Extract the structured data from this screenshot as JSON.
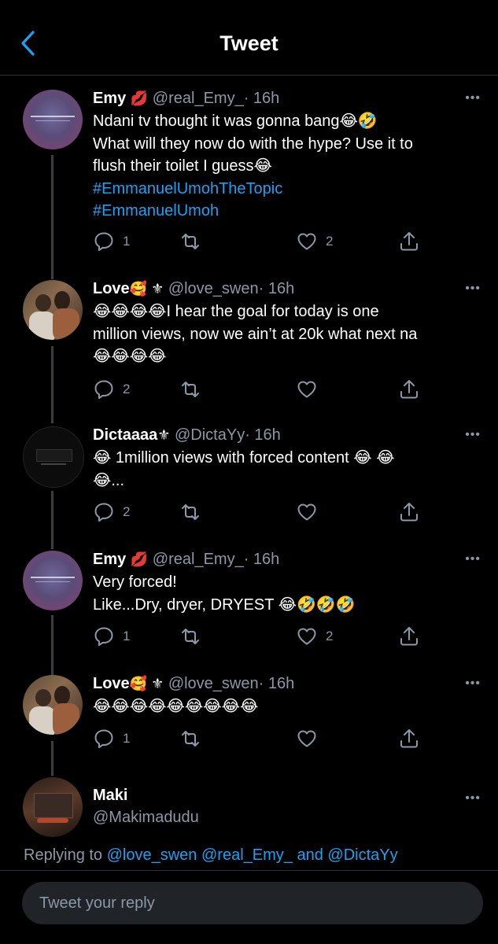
{
  "header": {
    "title": "Tweet",
    "back_icon": "chevron-left-icon"
  },
  "colors": {
    "accent": "#1da1f2",
    "muted": "#8b98a5",
    "background": "#000000"
  },
  "tweets": [
    {
      "name": "Emy",
      "badge": "💋",
      "handle": "@real_Emy_",
      "time": "· 16h",
      "lines": [
        "Ndani tv thought it was gonna bang😂🤣",
        "What will they now do with the hype? Use it to",
        "flush their toilet I guess😂"
      ],
      "hashtags": [
        "#EmmanuelUmohTheTopic",
        "#EmmanuelUmoh"
      ],
      "replies": "1",
      "retweets": "",
      "likes": "2"
    },
    {
      "name": "Love",
      "badge": "🥰 ⚜",
      "handle": "@love_swen",
      "time": "· 16h",
      "lines": [
        "😂😂😂😂I hear the goal for  today is one",
        "million views, now we ain’t at 20k what next na",
        "😂😂😂😂"
      ],
      "replies": "2",
      "retweets": "",
      "likes": ""
    },
    {
      "name": "Dictaaaa",
      "badge": "⚜",
      "handle": "@DictaYy",
      "time": "· 16h",
      "lines": [
        "😂 1million views with forced content 😂 😂",
        "😂..."
      ],
      "replies": "2",
      "retweets": "",
      "likes": ""
    },
    {
      "name": "Emy",
      "badge": "💋",
      "handle": "@real_Emy_",
      "time": "· 16h",
      "lines": [
        "Very forced!",
        "Like...Dry, dryer, DRYEST 😂🤣🤣🤣"
      ],
      "replies": "1",
      "retweets": "",
      "likes": "2"
    },
    {
      "name": "Love",
      "badge": "🥰 ⚜",
      "handle": "@love_swen",
      "time": "· 16h",
      "lines": [
        "😂😂😂😂😂😂😂😂😂"
      ],
      "replies": "1",
      "retweets": "",
      "likes": ""
    }
  ],
  "reply_author": {
    "name": "Maki",
    "handle": "@Makimadudu"
  },
  "replying": {
    "prefix": "Replying to",
    "mention1": "@love_swen",
    "mention2": "@real_Emy_",
    "conj": "and",
    "mention3": "@DictaYy"
  },
  "reply_input": {
    "placeholder": "Tweet your reply"
  }
}
